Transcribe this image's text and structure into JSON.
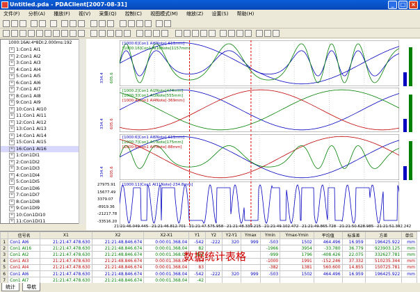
{
  "window": {
    "title": "Untitled.pda - PDAClient[2007-08-31]",
    "min": "_",
    "max": "□",
    "close": "×"
  },
  "menu": [
    "文件(F)",
    "分析(A)",
    "播放(F)",
    "视(V)",
    "采集(Q)",
    "控制(C)",
    "视图模式(M)",
    "缩放(Z)",
    "设置(S)",
    "帮助(H)"
  ],
  "tree": {
    "root": "1000:16AI:4*8DI:2.000ms:192",
    "items": [
      "1:Con1 AI1",
      "2:Con1 AI2",
      "3:Con1 AI3",
      "4:Con1 AI4",
      "5:Con1 AI5",
      "6:Con1 AI6",
      "7:Con1 AI7",
      "8:Con1 AI8",
      "9:Con1 AI9",
      "10:Con1 AI10",
      "11:Con1 AI11",
      "12:Con1 AI12",
      "13:Con1 AI13",
      "14:Con1 AI14",
      "15:Con1 AI15",
      "16:Con1 AI16",
      "1:Con1DI1",
      "2:Con1DI2",
      "3:Con1DI3",
      "4:Con1DI4",
      "5:Con1DI5",
      "6:Con1DI6",
      "7:Con1DI7",
      "8:Con1DI8",
      "9:Con1DI9",
      "10:Con1DI10",
      "11:Con1DI11",
      "12:Con1DI12"
    ],
    "selected": 15
  },
  "panels": [
    {
      "legend": [
        "[1000:6]Con1 AI6Note[-611mm]",
        "[1000:16]Con1 AI16Note[1157mm]"
      ],
      "axis": [
        "334.4",
        "605.6"
      ],
      "axis_colors": [
        "#0000c0",
        "#008000"
      ]
    },
    {
      "legend": [
        "[1000:2]Con1 AI2Note[474mm]",
        "[1000:3]Con1 AI3Note[555mm]",
        "[1000:4]Con1 AI4Note[-369mm]"
      ],
      "axis": [
        "334.4",
        "605.6"
      ],
      "axis_colors": [
        "#0000c0",
        "#c00000"
      ]
    },
    {
      "legend": [
        "[1000:6]Con1 AI6Note[-611mm]",
        "[1000:7]Con1 AI7Note[175mm]",
        "[1000:6]Con1 AI7Note[-88mm]"
      ],
      "axis": [
        "334.4",
        "605.6"
      ],
      "axis_colors": [
        "#0000c0",
        "#c00000"
      ]
    },
    {
      "legend": [
        "[1000:11]Con1 AI11Note[-234.8mm]"
      ],
      "axis": [
        "27975.91",
        "15677.49",
        "3379.07",
        "-8919.36",
        "-21217.78",
        "-33516.20"
      ],
      "axis_colors": [
        "#000000"
      ]
    }
  ],
  "xaxis": [
    "21:21:46.049.445",
    "21:21:46.812.701",
    "21:21:47.575.958",
    "21:21:48.339.215",
    "21:21:49.102.472",
    "21:21:49.865.728",
    "21:21:50.628.985",
    "21:21:51.392.242"
  ],
  "grid": {
    "headers": [
      "",
      "信号名",
      "X1",
      "X2",
      "X2-X1",
      "Y1",
      "Y2",
      "Y2-Y1",
      "Ymax",
      "Ymin",
      "Ymax-Ymin",
      "平均值",
      "标准差",
      "方差",
      "单位"
    ],
    "rows": [
      [
        "1",
        "Con1 AI6",
        "21:21:47.478.630",
        "21:21:48.846.674",
        "0:00:01.368.04",
        "-542",
        "-222",
        "320",
        "999",
        "-503",
        "1502",
        "464.496",
        "16.959",
        "196425.922",
        "mm"
      ],
      [
        "2",
        "Con1 AI16",
        "21:21:47.478.630",
        "21:21:48.846.674",
        "0:00:01.368.04",
        "82",
        "",
        "",
        "",
        "-1966",
        "3954",
        "-33.780",
        "36.779",
        "923903.125",
        "mm"
      ],
      [
        "3",
        "Con1 AI2",
        "21:21:47.478.630",
        "21:21:48.846.674",
        "0:00:01.368.04",
        "821",
        "",
        "",
        "",
        "-999",
        "1796",
        "-408.426",
        "22.075",
        "332627.781",
        "mm"
      ],
      [
        "4",
        "Con1 AI3",
        "21:21:47.478.630",
        "21:21:48.846.674",
        "0:00:01.368.04",
        "-904",
        "",
        "",
        "",
        "-1000",
        "1991",
        "-152.246",
        "37.332",
        "510235.344",
        "mm"
      ],
      [
        "5",
        "Con1 AI4",
        "21:21:47.478.630",
        "21:21:48.846.674",
        "0:00:01.368.04",
        "83",
        "",
        "",
        "",
        "-382",
        "1381",
        "560.600",
        "14.855",
        "150725.781",
        "mm"
      ],
      [
        "6",
        "Con1 AI6",
        "21:21:47.478.630",
        "21:21:48.846.674",
        "0:00:01.368.04",
        "-542",
        "-222",
        "320",
        "999",
        "-503",
        "1502",
        "464.496",
        "16.959",
        "196425.922",
        "mm"
      ],
      [
        "7",
        "Con1 AI7",
        "21:21:47.478.630",
        "21:21:48.846.674",
        "0:00:01.368.04",
        "-42",
        "",
        "",
        "",
        "",
        "",
        "",
        "",
        "",
        ""
      ]
    ]
  },
  "overlay": "数据统计表格",
  "tabs": [
    "统计",
    "导航"
  ]
}
